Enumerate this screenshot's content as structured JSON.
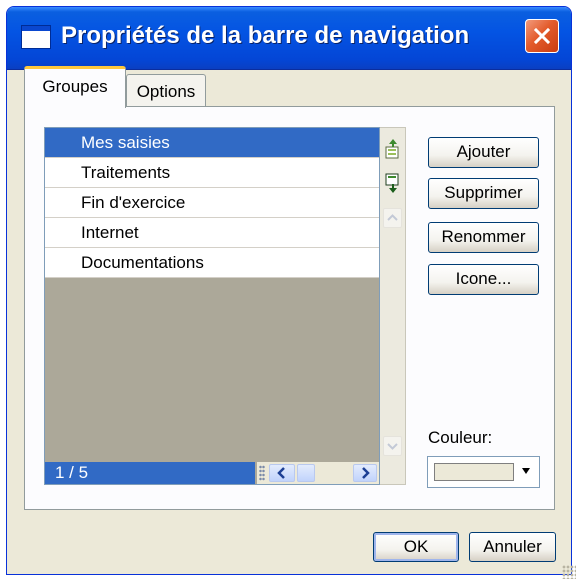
{
  "window": {
    "title": "Propriétés de la barre de navigation"
  },
  "tabs": [
    {
      "label": "Groupes",
      "active": true
    },
    {
      "label": "Options",
      "active": false
    }
  ],
  "group_list": {
    "items": [
      {
        "label": "Mes saisies",
        "selected": true
      },
      {
        "label": "Traitements",
        "selected": false
      },
      {
        "label": "Fin d'exercice",
        "selected": false
      },
      {
        "label": "Internet",
        "selected": false
      },
      {
        "label": "Documentations",
        "selected": false
      }
    ],
    "status": "1 / 5"
  },
  "side_buttons": {
    "add": "Ajouter",
    "delete": "Supprimer",
    "rename": "Renommer",
    "icon": "Icone..."
  },
  "color": {
    "label": "Couleur:",
    "value": "#ece9d8"
  },
  "footer": {
    "ok": "OK",
    "cancel": "Annuler"
  },
  "icons": {
    "window": "window-icon",
    "close": "close-icon",
    "move_up": "move-up-icon",
    "move_down": "move-down-icon"
  },
  "theme": {
    "titlebar": "#0454e3",
    "selection": "#316ac5",
    "dialog_bg": "#ece9d8",
    "close_button": "#e35b2b"
  }
}
